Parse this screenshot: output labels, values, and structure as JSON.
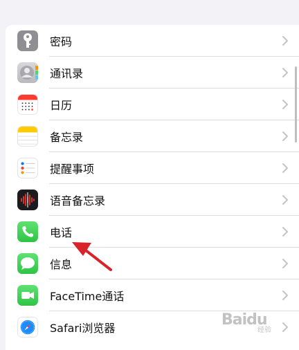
{
  "settings": {
    "items": [
      {
        "label": "密码",
        "icon": "key-icon"
      },
      {
        "label": "通讯录",
        "icon": "contacts-icon"
      },
      {
        "label": "日历",
        "icon": "calendar-icon"
      },
      {
        "label": "备忘录",
        "icon": "notes-icon"
      },
      {
        "label": "提醒事项",
        "icon": "reminders-icon"
      },
      {
        "label": "语音备忘录",
        "icon": "voice-memos-icon"
      },
      {
        "label": "电话",
        "icon": "phone-icon"
      },
      {
        "label": "信息",
        "icon": "messages-icon"
      },
      {
        "label": "FaceTime通话",
        "icon": "facetime-icon"
      },
      {
        "label": "Safari浏览器",
        "icon": "safari-icon"
      }
    ]
  },
  "watermark": {
    "brand": "Baidu",
    "sub": "经验"
  },
  "colors": {
    "annotation_arrow": "#d8232a",
    "chevron": "#c4c4c7",
    "separator": "#dcdce0"
  }
}
